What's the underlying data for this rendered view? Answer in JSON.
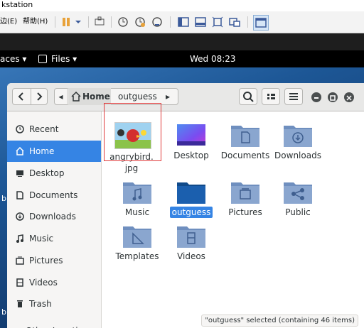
{
  "host": {
    "title": "kstation",
    "menu": [
      "边(E)",
      "帮助(H)"
    ],
    "accent": "#e8a23a"
  },
  "gnome": {
    "activities": "aces ▾",
    "files_menu": "Files ▾",
    "clock": "Wed 08:23"
  },
  "files": {
    "breadcrumb": {
      "home": "Home",
      "current": "outguess"
    },
    "sidebar": [
      {
        "label": "Recent",
        "icon": "recent-icon"
      },
      {
        "label": "Home",
        "icon": "home-icon",
        "active": true
      },
      {
        "label": "Desktop",
        "icon": "desktop-icon"
      },
      {
        "label": "Documents",
        "icon": "document-icon"
      },
      {
        "label": "Downloads",
        "icon": "download-icon"
      },
      {
        "label": "Music",
        "icon": "music-icon"
      },
      {
        "label": "Pictures",
        "icon": "pictures-icon"
      },
      {
        "label": "Videos",
        "icon": "videos-icon"
      },
      {
        "label": "Trash",
        "icon": "trash-icon"
      },
      {
        "label": "+ Other Locations",
        "icon": "other-locations-icon"
      }
    ],
    "items": [
      {
        "name": "angrybird.\njpg",
        "kind": "image"
      },
      {
        "name": "Desktop",
        "kind": "desktop"
      },
      {
        "name": "Documents",
        "kind": "folder"
      },
      {
        "name": "Downloads",
        "kind": "folder"
      },
      {
        "name": "Music",
        "kind": "folder"
      },
      {
        "name": "outguess",
        "kind": "folder",
        "selected": true
      },
      {
        "name": "Pictures",
        "kind": "folder"
      },
      {
        "name": "Public",
        "kind": "folder"
      },
      {
        "name": "Templates",
        "kind": "folder"
      },
      {
        "name": "Videos",
        "kind": "folder"
      }
    ],
    "status": "\"outguess\" selected  (containing 46 items)"
  }
}
